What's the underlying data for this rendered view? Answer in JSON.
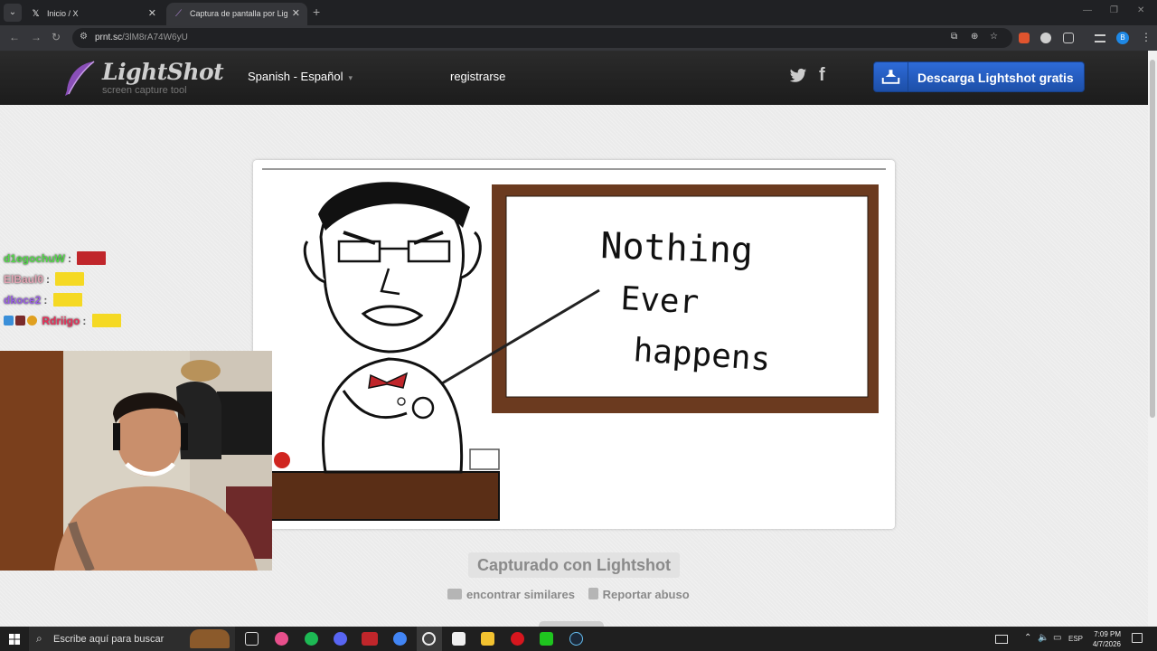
{
  "browser": {
    "tabs": [
      {
        "title": "Inicio / X",
        "icon": "x-logo-icon"
      },
      {
        "title": "Captura de pantalla por Lightshot",
        "icon": "lightshot-feather-icon"
      }
    ],
    "new_tab": "+",
    "url_host": "prnt.sc",
    "url_path": "/3lM8rA74W6yU",
    "profile_initial": "B"
  },
  "lightshot": {
    "logo_title": "LightShot",
    "logo_subtitle": "screen capture tool",
    "language": "Spanish - Español",
    "register": "registrarse",
    "download_button": "Descarga Lightshot gratis",
    "captured_with": "Capturado con Lightshot",
    "find_similar": "encontrar similares",
    "report_abuse": "Reportar abuso"
  },
  "screenshot": {
    "line1": "Nothing",
    "line2": "Ever",
    "line3": "happens"
  },
  "chat": [
    {
      "user": "d1egochuW",
      "color": "#54d94a",
      "emote": "#c0262b"
    },
    {
      "user": "ElBaul0",
      "color": "#e3a6b5",
      "emote": "#f5d923"
    },
    {
      "user": "dkoce2",
      "color": "#9b5fe6",
      "emote": "#f5d923"
    },
    {
      "user": "Rdriigo",
      "color": "#e8305a",
      "emote": "#f5d923"
    }
  ],
  "taskbar": {
    "search_placeholder": "Escribe aquí para buscar",
    "lang": "ESP",
    "time": "7:09 PM",
    "date": "4/7/2026"
  }
}
